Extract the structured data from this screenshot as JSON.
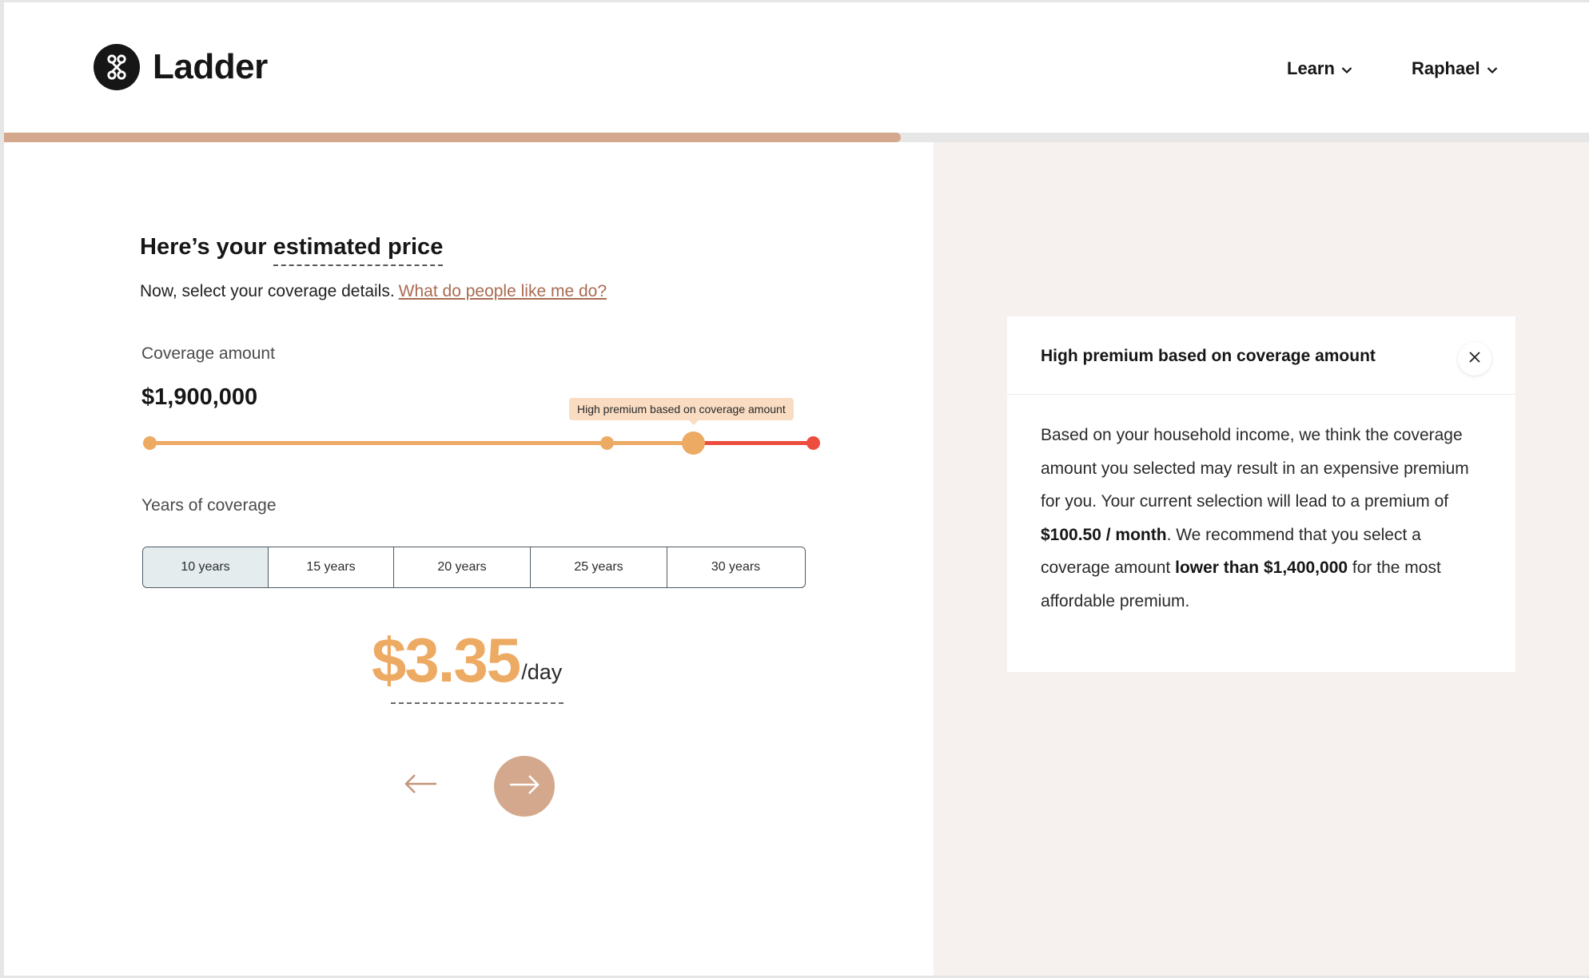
{
  "header": {
    "brand": "Ladder",
    "nav": [
      {
        "label": "Learn"
      },
      {
        "label": "Raphael"
      }
    ]
  },
  "progress": {
    "fraction": 0.566
  },
  "main": {
    "title_part1": "Here’s your",
    "title_part2": "estimated price",
    "subtitle": "Now, select your coverage details.",
    "subtitle_link": "What do people like me do?",
    "coverage": {
      "label": "Coverage amount",
      "value": "$1,900,000",
      "warning": "High premium based on coverage amount",
      "slider": {
        "fraction": 0.82,
        "recommended_fraction": 0.69
      }
    },
    "years": {
      "label": "Years of coverage",
      "options": [
        "10 years",
        "15 years",
        "20 years",
        "25 years",
        "30 years"
      ],
      "selected": "10 years"
    },
    "price": {
      "amount": "$3.35",
      "unit": "/day"
    }
  },
  "tip": {
    "title": "High premium based on coverage amount",
    "body_1": "Based on your household income, we think the coverage amount you selected may result in an expensive premium for you. Your current selection will lead to a premium of ",
    "body_bold_1": "$100.50 / month",
    "body_2": ". We recommend that you select a coverage amount ",
    "body_bold_2": "lower than $1,400,000",
    "body_3": " for the most affordable premium."
  },
  "colors": {
    "accent": "#d3a88d",
    "slider_ok": "#edaa63",
    "slider_warn": "#ec4d3f",
    "panel_bg": "#f6f1ee"
  },
  "icons": [
    "ladder-logo-icon",
    "chevron-down-icon",
    "close-icon",
    "arrow-left-icon",
    "arrow-right-icon"
  ]
}
